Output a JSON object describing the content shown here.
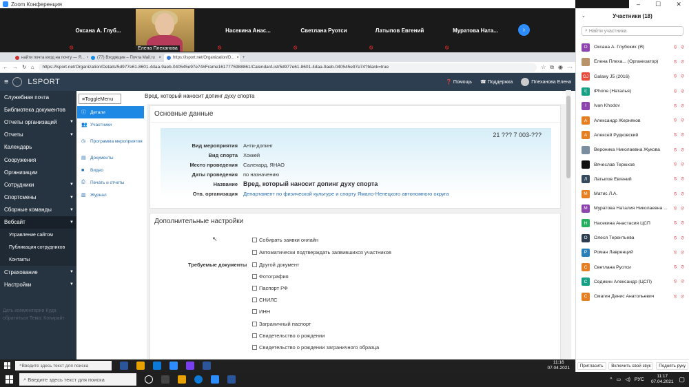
{
  "zoom": {
    "title": "Zoom Конференция",
    "tiles": [
      "Оксана А. Глуб...",
      "Насекина Анас...",
      "Светлана Руотси",
      "Латыпов Евгений",
      "Муратова Ната..."
    ],
    "video_name": "Елена Плеханова"
  },
  "browser": {
    "tabs": [
      {
        "label": "найти почта вход на почту — Я..."
      },
      {
        "label": "(77) Входящие – Почта Mail.ru"
      },
      {
        "label": "https://lsport.net/Organization/D..."
      }
    ],
    "url": "https://lsport.net/Organization/Details/5d977e61-8601-4daa-9aeb-040545e97e74#Frame1617775988861/Calendar/List/5d977e61-8601-4daa-9aeb-040545e97e74?blank=true"
  },
  "lsport": {
    "brand": "LSPORT",
    "help": "Помощь",
    "support": "Поддержка",
    "user": "Плеханова Елена"
  },
  "sidebar": {
    "items": [
      {
        "label": "Служебная почта"
      },
      {
        "label": "Библиотека документов"
      },
      {
        "label": "Отчеты организаций"
      },
      {
        "label": "Отчеты"
      },
      {
        "label": "Календарь"
      },
      {
        "label": "Сооружения"
      },
      {
        "label": "Организации"
      },
      {
        "label": "Сотрудники"
      },
      {
        "label": "Спортсмены"
      },
      {
        "label": "Сборные команды"
      },
      {
        "label": "Вебсайт"
      }
    ],
    "subs": [
      {
        "label": "Управление сайтом"
      },
      {
        "label": "Публикация сотрудников"
      },
      {
        "label": "Контакты"
      }
    ],
    "after": [
      {
        "label": "Страхование"
      },
      {
        "label": "Настройки"
      }
    ],
    "footer": "Дать комментарии Куда обратиться Тема: Копирайт"
  },
  "content": {
    "toggle": "ToggleMenu",
    "page_title": "Вред, который наносит допинг духу спорта",
    "subnav": [
      {
        "label": "Детали"
      },
      {
        "label": "Участники"
      },
      {
        "label": "Программа мероприятия"
      },
      {
        "label": "Документы"
      },
      {
        "label": "Видео"
      },
      {
        "label": "Печать и отчеты"
      },
      {
        "label": "Журнал"
      }
    ],
    "basic_title": "Основные данные",
    "number": "21 ??? 7 003-???",
    "fields": [
      {
        "k": "Вид мероприятия",
        "v": "Анти-допинг"
      },
      {
        "k": "Вид спорта",
        "v": "Хоккей"
      },
      {
        "k": "Место проведения",
        "v": "Салехард, ЯНАО"
      },
      {
        "k": "Даты проведения",
        "v": "по назначению"
      },
      {
        "k": "Название",
        "v": "Вред, который наносит допинг духу спорта"
      },
      {
        "k": "Отв. организация",
        "v": "Департамент по физической культуре и спорту Ямало-Ненецкого автономного округа"
      }
    ],
    "extra_title": "Дополнительные настройки",
    "opts": [
      "Собирать заявки онлайн",
      "Автоматически подтверждать заявившихся участников"
    ],
    "req_label": "Требуемые документы",
    "docs": [
      "Другой документ",
      "Фотография",
      "Паспорт РФ",
      "СНИЛС",
      "ИНН",
      "Заграничный паспорт",
      "Свидетельство о рождении",
      "Свидетельство о рождении заграничного образца"
    ]
  },
  "participants": {
    "title": "Участники (18)",
    "search_placeholder": "Найти участника",
    "list": [
      {
        "name": "Оксана А. Глубоких (Я)",
        "letter": "О",
        "color": "#8e44ad"
      },
      {
        "name": "Елена Плеха... (Организатор)",
        "letter": "",
        "color": "#b9936a"
      },
      {
        "name": "Galaxy J5 (2016)",
        "letter": "GJ",
        "color": "#e74c3c"
      },
      {
        "name": "iPhone (Наталья)",
        "letter": "I(",
        "color": "#16a085"
      },
      {
        "name": "Ivan Khodov",
        "letter": "I",
        "color": "#8e44ad"
      },
      {
        "name": "Александр Жерняков",
        "letter": "А",
        "color": "#e67e22"
      },
      {
        "name": "Алексей Рудковский",
        "letter": "А",
        "color": "#e67e22"
      },
      {
        "name": "Вероника Николаевна Жукова",
        "letter": "",
        "color": "#7a8ea0"
      },
      {
        "name": "Вячеслав Терюхов",
        "letter": "",
        "color": "#111111"
      },
      {
        "name": "Латыпов Евгений",
        "letter": "Л",
        "color": "#34495e"
      },
      {
        "name": "Матис Л.А.",
        "letter": "М",
        "color": "#e67e22"
      },
      {
        "name": "Муратова Наталия Николаевна ...",
        "letter": "М",
        "color": "#8e44ad"
      },
      {
        "name": "Насекина Анастасия ЦСП",
        "letter": "Н",
        "color": "#27ae60"
      },
      {
        "name": "Олеся Терентьева",
        "letter": "О",
        "color": "#2c3e50"
      },
      {
        "name": "Роман Лавренций",
        "letter": "Р",
        "color": "#2980b9"
      },
      {
        "name": "Светлана Руотси",
        "letter": "С",
        "color": "#e67e22"
      },
      {
        "name": "Седикин Александр (ЦСП)",
        "letter": "С",
        "color": "#16a085"
      },
      {
        "name": "Смагин Денис Анатольевич",
        "letter": "С",
        "color": "#e67e22"
      }
    ],
    "footer": [
      "Пригласить",
      "Включить свой звук",
      "Поднять руку"
    ]
  },
  "taskbar": {
    "search": "Введите здесь текст для поиска",
    "lang": "РУС",
    "time": "11:17",
    "date": "07.04.2021",
    "inner_time": "11:16",
    "inner_date": "07.04.2021"
  }
}
